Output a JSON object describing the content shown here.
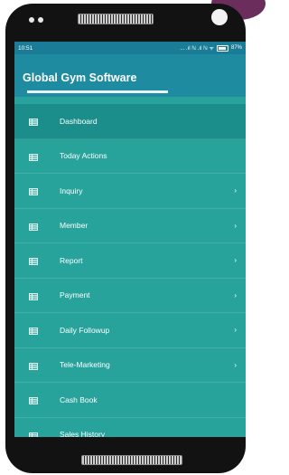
{
  "status_bar": {
    "time": "10:51",
    "indicators": "... .ıl ℕ .ıl ℕ ᯤ",
    "battery": "87%"
  },
  "app_bar": {
    "title": "Global Gym Software"
  },
  "menu": {
    "items": [
      {
        "label": "Dashboard",
        "icon": "list-icon",
        "chevron": ""
      },
      {
        "label": "Today Actions",
        "icon": "list-icon",
        "chevron": ""
      },
      {
        "label": "Inquiry",
        "icon": "list-icon",
        "chevron": "›"
      },
      {
        "label": "Member",
        "icon": "list-icon",
        "chevron": "›"
      },
      {
        "label": "Report",
        "icon": "list-icon",
        "chevron": "›"
      },
      {
        "label": "Payment",
        "icon": "list-icon",
        "chevron": "›"
      },
      {
        "label": "Daily Followup",
        "icon": "list-icon",
        "chevron": "›"
      },
      {
        "label": "Tele-Marketing",
        "icon": "list-icon",
        "chevron": "›"
      },
      {
        "label": "Cash Book",
        "icon": "list-icon",
        "chevron": ""
      },
      {
        "label": "Sales History",
        "icon": "list-icon",
        "chevron": ""
      }
    ]
  },
  "colors": {
    "drawer_bg": "#27a39c",
    "app_bar_bg": "#1f8ba0",
    "status_bar_bg": "#1a7c96",
    "active_item_bg": "#1b8d8b"
  }
}
